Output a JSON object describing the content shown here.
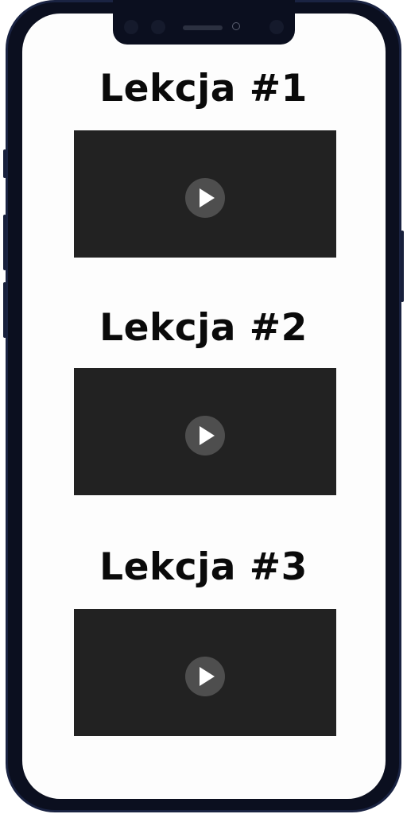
{
  "lessons": [
    {
      "title": "Lekcja #1",
      "play_icon": "play-icon"
    },
    {
      "title": "Lekcja #2",
      "play_icon": "play-icon"
    },
    {
      "title": "Lekcja #3",
      "play_icon": "play-icon"
    }
  ],
  "colors": {
    "frame": "#0b0f1f",
    "screen": "#fdfdfd",
    "video_background": "#222222",
    "play_button": "#4e4e4e",
    "title_text": "#0a0a0a"
  }
}
